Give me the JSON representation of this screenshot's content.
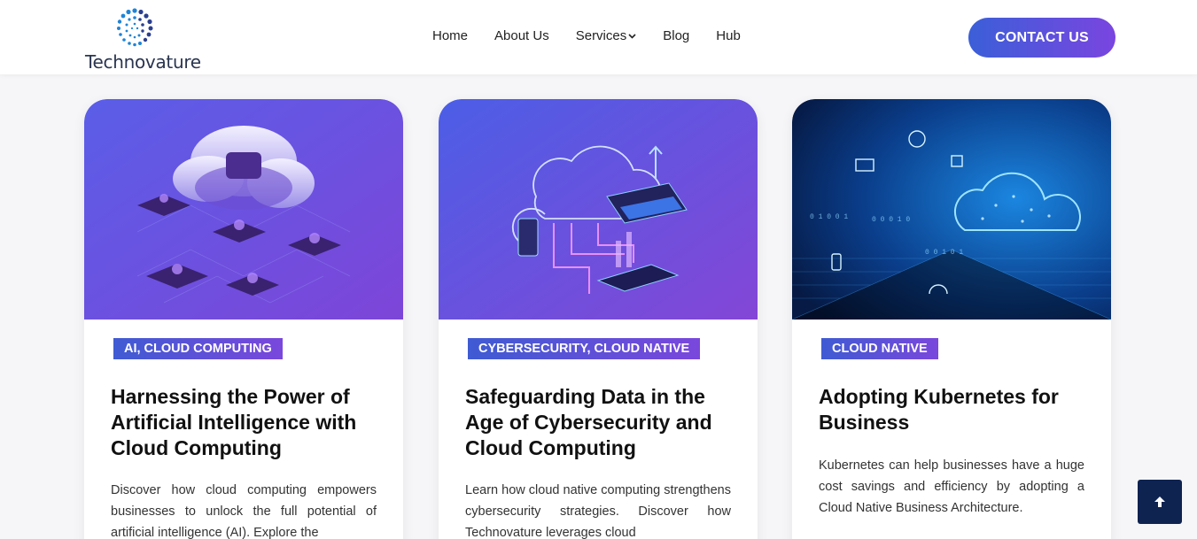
{
  "brand": {
    "name": "Technovature"
  },
  "nav": {
    "home": "Home",
    "about": "About Us",
    "services": "Services",
    "blog": "Blog",
    "hub": "Hub"
  },
  "header": {
    "contact_label": "CONTACT US"
  },
  "cards": [
    {
      "tag": "AI, CLOUD COMPUTING",
      "title": "Harnessing the Power of Artificial Intelligence with Cloud Computing",
      "description": "Discover how cloud computing empowers businesses to unlock the full potential of artificial intelligence (AI). Explore the"
    },
    {
      "tag": "CYBERSECURITY, CLOUD NATIVE",
      "title": "Safeguarding Data in the Age of Cybersecurity and Cloud Computing",
      "description": "Learn how cloud native computing strengthens cybersecurity strategies. Discover how Technovature leverages cloud"
    },
    {
      "tag": "CLOUD NATIVE",
      "title": "Adopting Kubernetes for Business",
      "description": "Kubernetes can help businesses have a huge cost savings and efficiency by adopting a Cloud Native Business Architecture."
    }
  ],
  "icons": {
    "services_chevron": "chevron-down-icon",
    "scroll_top": "arrow-up-icon"
  },
  "colors": {
    "accent_start": "#3b5fd8",
    "accent_end": "#7a45e0",
    "scroll_top_bg": "#0e2350"
  }
}
